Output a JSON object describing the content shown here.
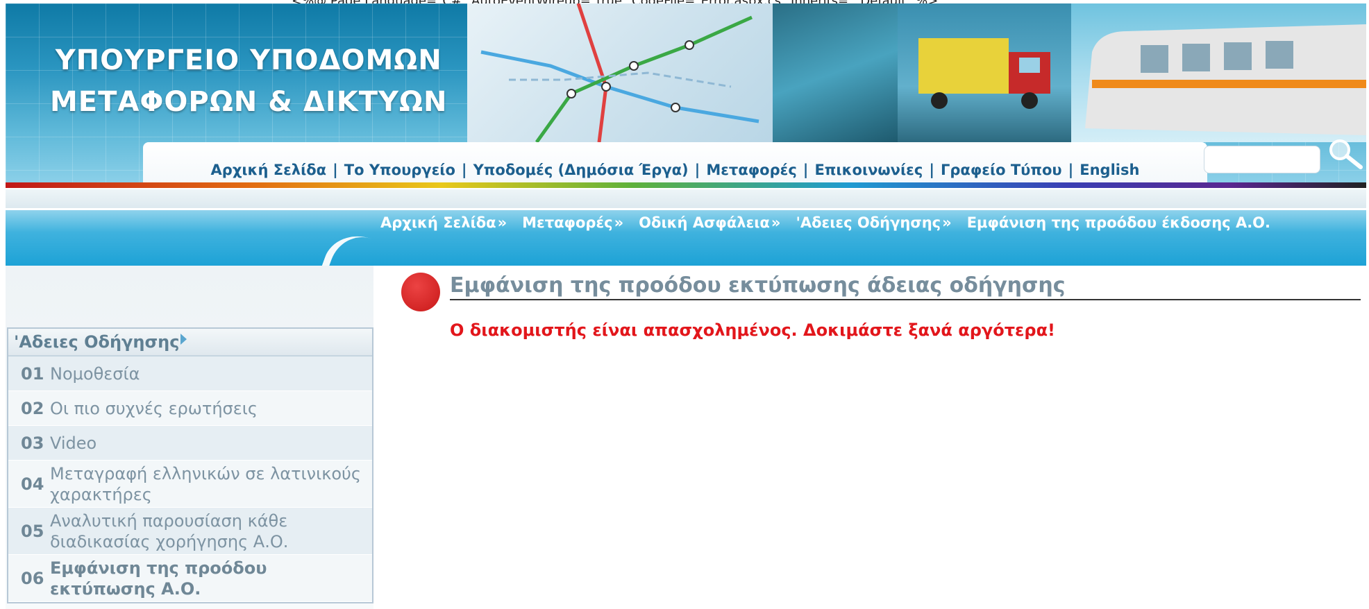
{
  "stray_text": "<%@ Page Language=\"C#\" AutoEventWireup=\"true\" CodeFile=\"Error.aspx.cs\" Inherits=\"_Default\" %>",
  "header": {
    "ministry_line1": "ΥΠΟΥΡΓΕΙΟ ΥΠΟΔΟΜΩΝ",
    "ministry_line2": "ΜΕΤΑΦΟΡΩΝ & ΔΙΚΤΥΩΝ"
  },
  "nav": {
    "items": [
      "Αρχική Σελίδα",
      "Το Υπουργείο",
      "Υποδομές (Δημόσια Έργα)",
      "Μεταφορές",
      "Επικοινωνίες",
      "Γραφείο Τύπου",
      "English"
    ],
    "separator": "|"
  },
  "search": {
    "value": "",
    "icon": "magnifier-icon"
  },
  "breadcrumb": {
    "items": [
      "Αρχική Σελίδα",
      "Μεταφορές",
      "Οδική Ασφάλεια",
      "'Αδειες Οδήγησης",
      "Εμφάνιση της προόδου έκδοσης Α.Ο."
    ],
    "separator": "»"
  },
  "sidebar": {
    "title": "'Αδειες Οδήγησης",
    "items": [
      {
        "num": "01",
        "label": "Νομοθεσία"
      },
      {
        "num": "02",
        "label": "Οι πιο συχνές ερωτήσεις"
      },
      {
        "num": "03",
        "label": "Video"
      },
      {
        "num": "04",
        "label": "Μεταγραφή ελληνικών σε λατινικούς χαρακτήρες"
      },
      {
        "num": "05",
        "label": "Αναλυτική παρουσίαση κάθε διαδικασίας χορήγησης Α.Ο."
      },
      {
        "num": "06",
        "label": "Εμφάνιση της προόδου εκτύπωσης Α.Ο."
      }
    ]
  },
  "main": {
    "title": "Εμφάνιση της προόδου εκτύπωσης άδειας οδήγησης",
    "error": "Ο διακομιστής είναι απασχολημένος. Δοκιμάστε ξανά αργότερα!"
  },
  "colors": {
    "accent": "#1c5f8e",
    "error": "#e2161b",
    "title": "#768d9c"
  }
}
